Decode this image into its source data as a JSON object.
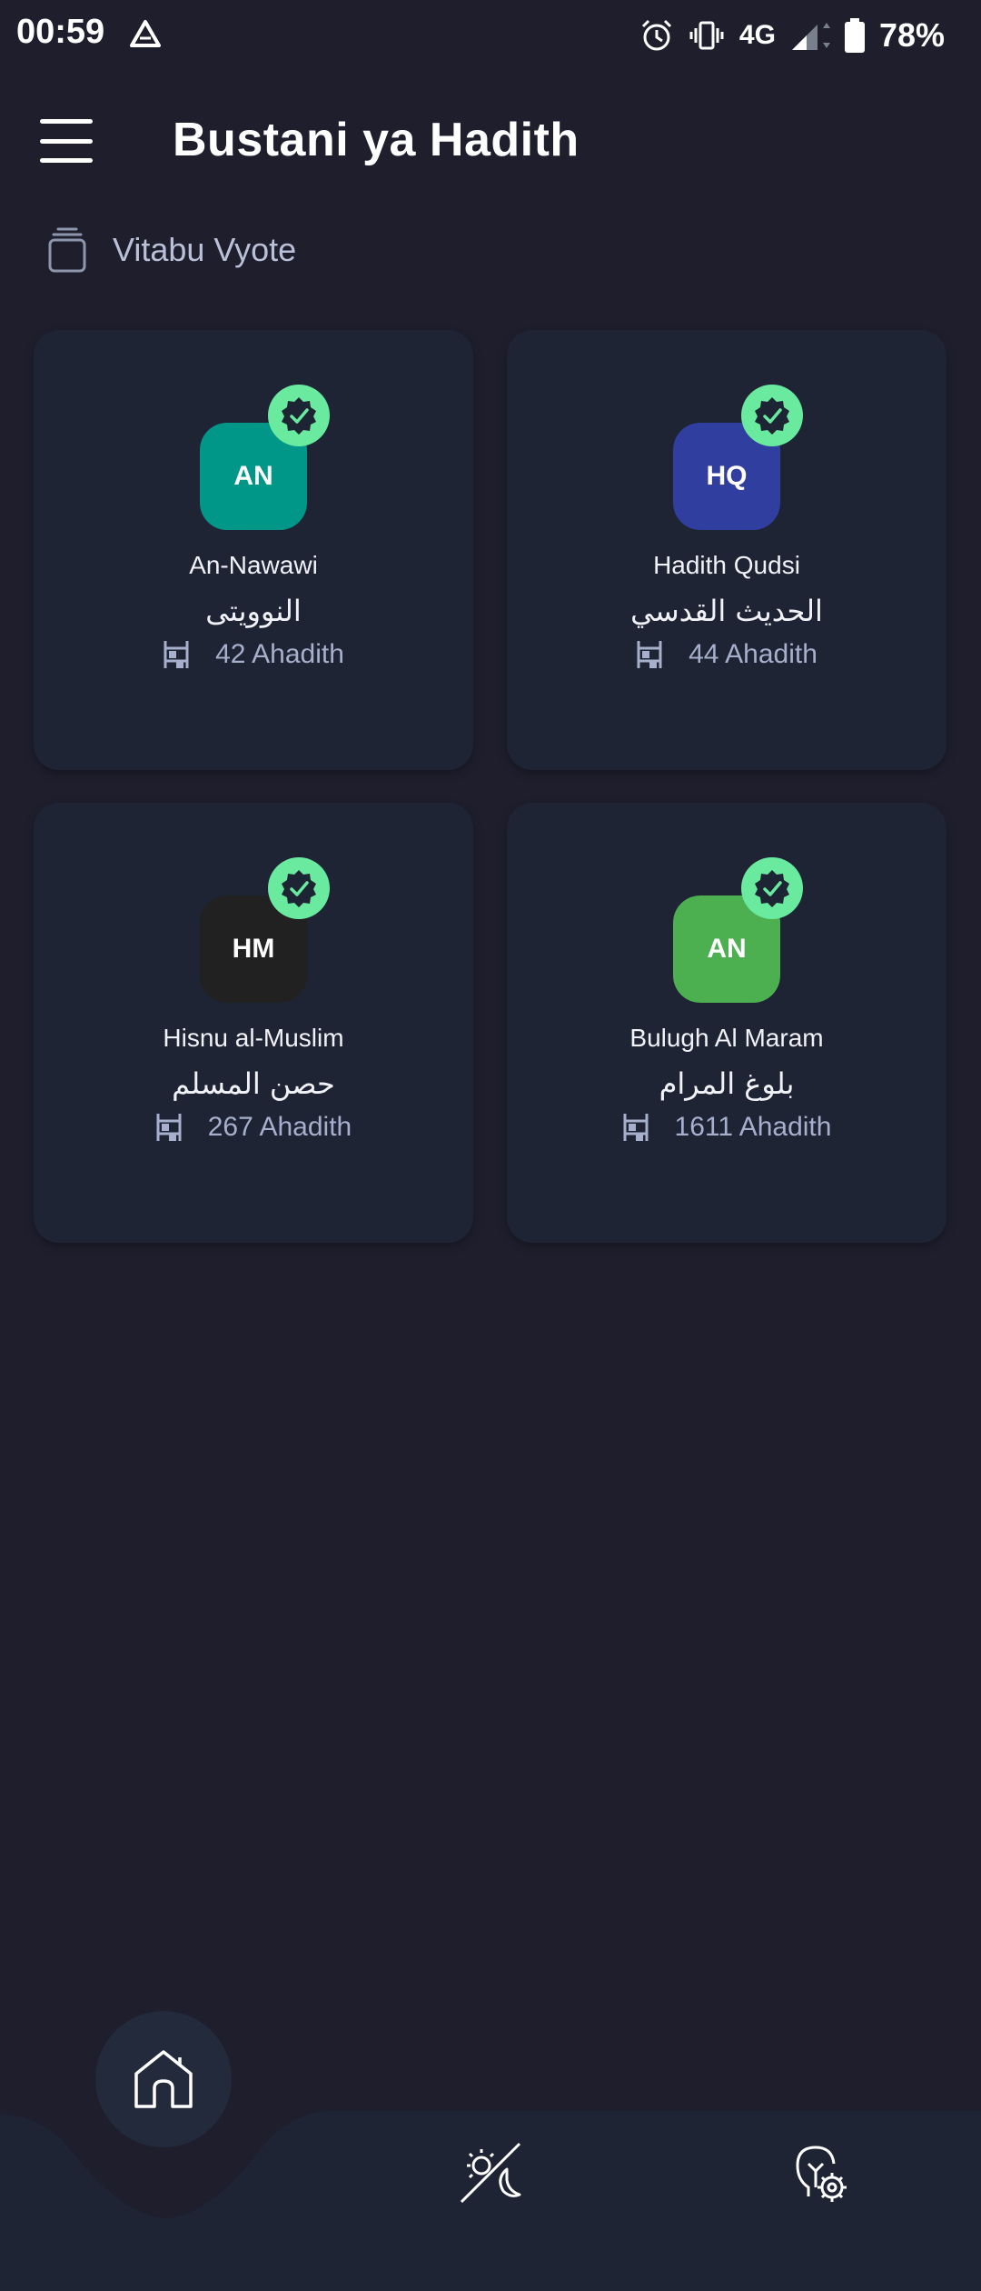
{
  "status_bar": {
    "time": "00:59",
    "network": "4G",
    "battery": "78%"
  },
  "app_bar": {
    "title": "Bustani ya Hadith"
  },
  "section": {
    "title": "Vitabu Vyote"
  },
  "books": [
    {
      "initials": "AN",
      "name": "An-Nawawi",
      "arabic": "النوويتى",
      "count": "42 Ahadith",
      "color": "#009688"
    },
    {
      "initials": "HQ",
      "name": "Hadith Qudsi",
      "arabic": "الحديث القدسي",
      "count": "44 Ahadith",
      "color": "#303f9f"
    },
    {
      "initials": "HM",
      "name": "Hisnu al-Muslim",
      "arabic": "حصن المسلم",
      "count": "267 Ahadith",
      "color": "#212121"
    },
    {
      "initials": "AN",
      "name": "Bulugh Al Maram",
      "arabic": "بلوغ المرام",
      "count": "1611 Ahadith",
      "color": "#4caf50"
    }
  ],
  "colors": {
    "background": "#1e1e2d",
    "card": "#1f2435",
    "verified_badge": "#69ea9f"
  },
  "bottom_nav": {
    "items": [
      "home-icon",
      "theme-toggle-icon",
      "settings-bulb-icon"
    ]
  }
}
